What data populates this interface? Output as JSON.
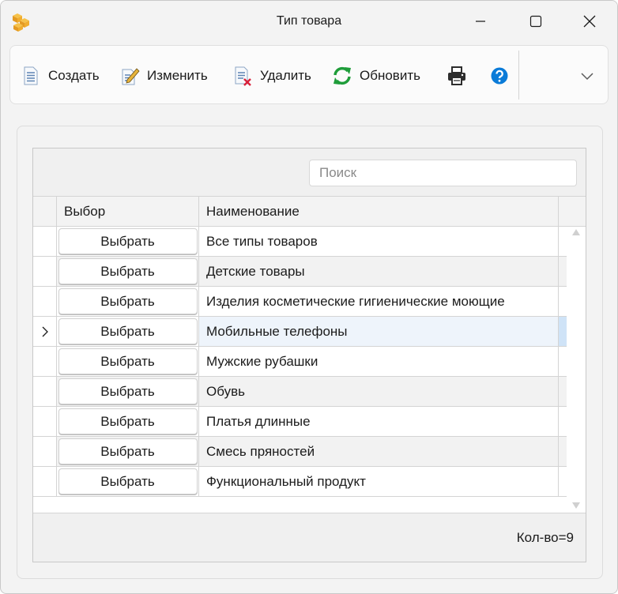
{
  "window": {
    "title": "Тип товара",
    "app_icon": "cube-box-icon",
    "controls": [
      "minimize-icon",
      "maximize-icon",
      "close-icon"
    ]
  },
  "toolbar": {
    "create_label": "Создать",
    "edit_label": "Изменить",
    "delete_label": "Удалить",
    "refresh_label": "Обновить",
    "print_icon": "printer-icon",
    "help_icon": "help-icon",
    "overflow_icon": "chevron-down-icon"
  },
  "grid": {
    "search_placeholder": "Поиск",
    "columns": {
      "pick": "Выбор",
      "name": "Наименование"
    },
    "rows": [
      {
        "pick_label": "Выбрать",
        "name": "Все типы товаров",
        "selected": false
      },
      {
        "pick_label": "Выбрать",
        "name": "Детские товары",
        "selected": false
      },
      {
        "pick_label": "Выбрать",
        "name": "Изделия косметические гигиенические моющие",
        "selected": false
      },
      {
        "pick_label": "Выбрать",
        "name": "Мобильные телефоны",
        "selected": true
      },
      {
        "pick_label": "Выбрать",
        "name": "Мужские рубашки",
        "selected": false
      },
      {
        "pick_label": "Выбрать",
        "name": "Обувь",
        "selected": false
      },
      {
        "pick_label": "Выбрать",
        "name": "Платья длинные",
        "selected": false
      },
      {
        "pick_label": "Выбрать",
        "name": "Смесь пряностей",
        "selected": false
      },
      {
        "pick_label": "Выбрать",
        "name": "Функциональный продукт",
        "selected": false
      }
    ],
    "count_text": "Кол-во=9"
  },
  "colors": {
    "accent": "#0a7bd8",
    "refresh_green": "#1f9d3a",
    "delete_red": "#d9213a",
    "selected_row": "#cfe3f7"
  }
}
